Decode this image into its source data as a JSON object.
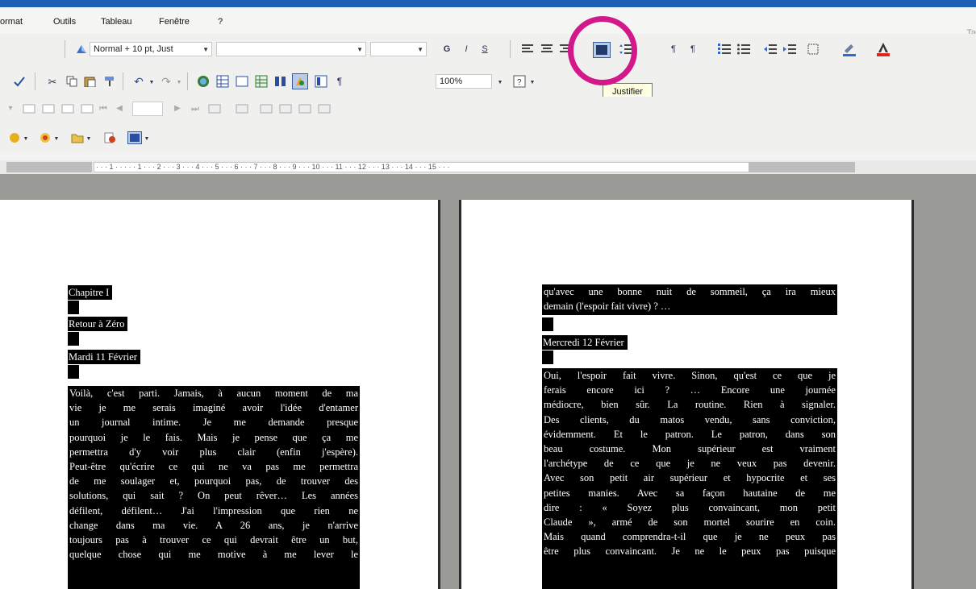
{
  "menubar": {
    "items": [
      "ormat",
      "Outils",
      "Tableau",
      "Fenêtre",
      "?"
    ],
    "right_cut": "Ta"
  },
  "toolbar": {
    "style_combo": "Normal + 10 pt, Just",
    "zoom_combo": "100%",
    "tooltip": "Justifier"
  },
  "ruler": {
    "ticks": "· · · 1 · · · · · 1 · · · 2 · · · 3 · · · 4 · · · 5 · · · 6 · · · 7 · · · 8 · · · 9 · · · 10 · · · 11 · · · 12 · · · 13 · · · 14 · · · 15 · · ·"
  },
  "left_page": {
    "heading1": "Chapitre I",
    "heading2": "Retour à Zéro",
    "heading3": "Mardi 11 Février",
    "body": [
      "Voilà, c'est parti. Jamais, à aucun moment de ma",
      "vie je me serais imaginé avoir l'idée d'entamer",
      "un journal intime. Je me demande presque",
      "pourquoi je le fais. Mais je pense que ça me",
      "permettra d'y voir plus clair (enfin j'espère).",
      "Peut-être qu'écrire ce qui ne va pas me permettra",
      "de me soulager et, pourquoi pas, de trouver des",
      "solutions, qui sait ? On peut rêver… Les années",
      "défilent, défilent… J'ai l'impression que rien ne",
      "change dans ma vie. A 26 ans, je n'arrive",
      "toujours pas à trouver ce qui devrait être un but,",
      "quelque chose qui me motive à me lever le"
    ]
  },
  "right_page": {
    "top_lines": [
      "qu'avec une bonne nuit de sommeil, ça ira mieux",
      "demain (l'espoir fait vivre) ? …"
    ],
    "heading": "Mercredi 12 Février",
    "body": [
      "Oui, l'espoir fait vivre. Sinon, qu'est ce que je",
      "ferais encore ici ? … Encore une journée",
      "médiocre, bien sûr. La routine. Rien à signaler.",
      "Des clients, du matos vendu, sans conviction,",
      "évidemment. Et le patron. Le patron, dans son",
      "beau costume. Mon supérieur est vraiment",
      "l'archétype de ce que je ne veux pas devenir.",
      "Avec son petit air supérieur et hypocrite et ses",
      "petites manies. Avec sa façon hautaine de me",
      "dire : « Soyez plus convaincant, mon petit",
      "Claude », armé de son mortel sourire en coin.",
      "Mais quand comprendra-t-il que je ne peux pas",
      "être plus convaincant. Je ne le peux pas puisque"
    ]
  }
}
